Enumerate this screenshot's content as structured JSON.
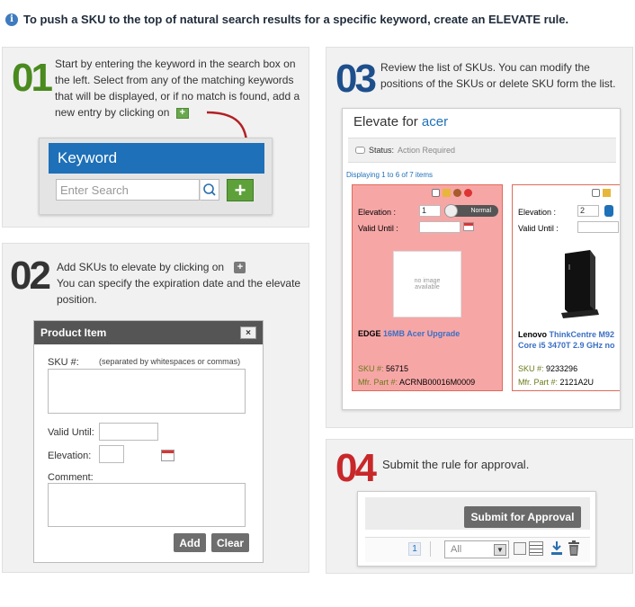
{
  "header": {
    "title": "To push a SKU to the top of natural search results for a specific keyword, create an ELEVATE rule."
  },
  "step1": {
    "number": "01",
    "text": "Start by entering the keyword in the search box on the left. Select from any of the matching keywords that will be displayed, or if no match is found, add a new entry by clicking on",
    "keyword_title": "Keyword",
    "search_placeholder": "Enter Search",
    "add_symbol": "+"
  },
  "step2": {
    "number": "02",
    "text_a": "Add SKUs to elevate by clicking on",
    "text_b": "You can specify the expiration date and the elevate position.",
    "dialog_title": "Product Item",
    "close_symbol": "×",
    "sku_label": "SKU #:",
    "sku_hint": "(separated by whitespaces or commas)",
    "valid_until_label": "Valid Until:",
    "elevation_label": "Elevation:",
    "comment_label": "Comment:",
    "add_label": "Add",
    "clear_label": "Clear"
  },
  "step3": {
    "number": "03",
    "text": "Review the list of SKUs. You can modify the positions of the SKUs or delete SKU form the list.",
    "elevate_title_prefix": "Elevate for",
    "elevate_keyword": "acer",
    "status_label": "Status:",
    "status_value": "Action Required",
    "displaying": "Displaying 1 to 6 of 7 items",
    "cards": [
      {
        "elevation_label": "Elevation :",
        "elevation_value": "1",
        "status_pill": "Normal",
        "valid_until_label": "Valid Until :",
        "no_image": "no image available",
        "brand": "EDGE",
        "product": "16MB Acer Upgrade",
        "sku_label": "SKU #:",
        "sku_value": "56715",
        "mfr_label": "Mfr. Part #:",
        "mfr_value": "ACRNB00016M0009"
      },
      {
        "elevation_label": "Elevation :",
        "elevation_value": "2",
        "valid_until_label": "Valid Until :",
        "brand": "Lenovo",
        "product": "ThinkCentre M92 Core i5 3470T 2.9 GHz no",
        "sku_label": "SKU #:",
        "sku_value": "9233296",
        "mfr_label": "Mfr. Part #:",
        "mfr_value": "2121A2U"
      }
    ]
  },
  "step4": {
    "number": "04",
    "text": "Submit the rule for approval.",
    "submit_label": "Submit for Approval",
    "page_number": "1",
    "filter_value": "All"
  },
  "colors": {
    "step1": "#4a8a1e",
    "step2": "#333333",
    "step3": "#1d4f8c",
    "step4": "#c8282a",
    "card_red": "#f7a6a6",
    "card_border_red": "#e06a5a"
  }
}
